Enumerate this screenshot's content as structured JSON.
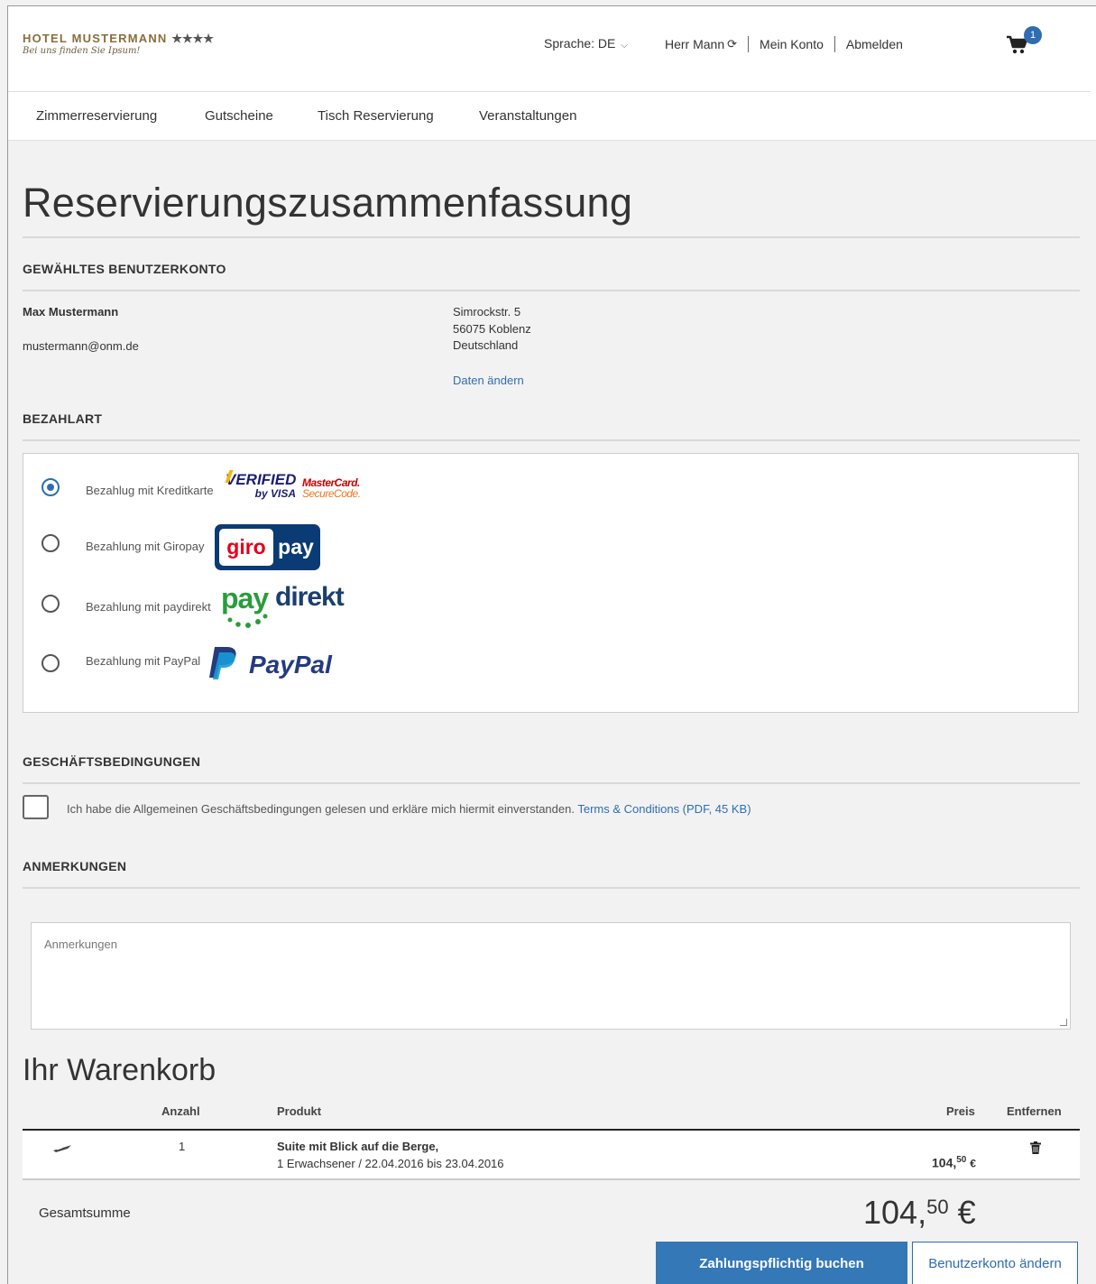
{
  "header": {
    "logo_title": "HOTEL MUSTERMANN",
    "logo_stars": "★★★★",
    "logo_tagline": "Bei uns finden Sie Ipsum!",
    "language_label": "Sprache: DE",
    "user_name": "Herr Mann",
    "account_link": "Mein Konto",
    "logout_link": "Abmelden",
    "cart_count": "1"
  },
  "nav": {
    "items": [
      "Zimmerreservierung",
      "Gutscheine",
      "Tisch Reservierung",
      "Veranstaltungen"
    ]
  },
  "page": {
    "title": "Reservierungszusammenfassung"
  },
  "account": {
    "heading": "GEWÄHLTES BENUTZERKONTO",
    "name": "Max Mustermann",
    "email": "mustermann@onm.de",
    "street": "Simrockstr. 5",
    "city": "56075 Koblenz",
    "country": "Deutschland",
    "edit_link": "Daten ändern"
  },
  "payment": {
    "heading": "BEZAHLART",
    "options": [
      {
        "label": "Bezahlug mit Kreditkarte",
        "selected": true
      },
      {
        "label": "Bezahlung mit Giropay",
        "selected": false
      },
      {
        "label": "Bezahlung mit paydirekt",
        "selected": false
      },
      {
        "label": "Bezahlung mit PayPal",
        "selected": false
      }
    ],
    "logos": {
      "verified_top": "VERIFIED",
      "verified_bottom": "by VISA",
      "mastercard_top": "MasterCard.",
      "mastercard_bottom": "SecureCode.",
      "giro": "giro",
      "giro_pay": "pay",
      "paydirekt_pay": "pay",
      "paydirekt_direkt": "direkt",
      "paypal": "PayPal"
    }
  },
  "terms": {
    "heading": "GESCHÄFTSBEDINGUNGEN",
    "text": "Ich habe die Allgemeinen Geschäftsbedingungen gelesen und erkläre mich hiermit einverstanden.",
    "link": "Terms & Conditions (PDF, 45 KB)"
  },
  "notes": {
    "heading": "ANMERKUNGEN",
    "placeholder": "Anmerkungen"
  },
  "cart": {
    "title": "Ihr Warenkorb",
    "columns": {
      "qty": "Anzahl",
      "product": "Produkt",
      "price": "Preis",
      "remove": "Entfernen"
    },
    "items": [
      {
        "qty": "1",
        "product": "Suite mit Blick auf die Berge,",
        "details": "1 Erwachsener / 22.04.2016 bis 23.04.2016",
        "price_main": "104,",
        "price_cents": "50",
        "currency": "€"
      }
    ],
    "total_label": "Gesamtsumme",
    "total_main": "104,",
    "total_cents": "50",
    "total_currency": "€"
  },
  "actions": {
    "book": "Zahlungspflichtig buchen",
    "change_account": "Benutzerkonto ändern"
  },
  "colors": {
    "accent": "#2f6db0",
    "primary_button": "#3478b8",
    "logo_gold": "#8a6d3b"
  }
}
